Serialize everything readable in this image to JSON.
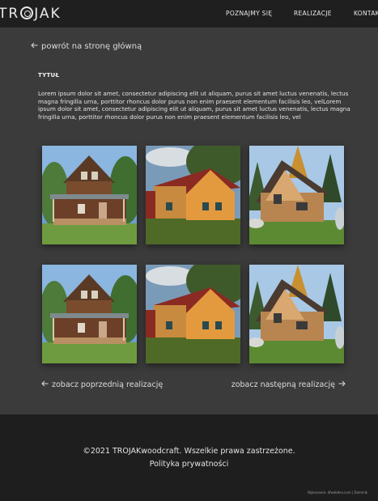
{
  "header": {
    "logo_prefix": "TR",
    "logo_suffix": "JAK",
    "nav": [
      {
        "label": "POZNAJMY SIĘ"
      },
      {
        "label": "REALIZACJE"
      },
      {
        "label": "KONTAKT"
      }
    ]
  },
  "back_link": {
    "icon": "arrow-left-icon",
    "label": "powrót na stronę główną"
  },
  "project": {
    "title": "TYTUŁ",
    "description": "Lorem ipsum dolor sit amet, consectetur adipiscing elit ut aliquam, purus sit amet luctus venenatis, lectus magna fringilla urna, porttitor rhoncus dolor purus non enim praesent elementum facilisis leo, velLorem ipsum dolor sit amet, consectetur adipiscing elit ut aliquam, purus sit amet luctus venenatis, lectus magna fringilla urna, porttitor rhoncus dolor purus non enim praesent elementum facilisis leo, vel"
  },
  "gallery": [
    {
      "subject": "brown-log-house-with-porch"
    },
    {
      "subject": "orange-barn-red-roof"
    },
    {
      "subject": "log-cabin-pine-trees"
    },
    {
      "subject": "brown-log-house-with-porch"
    },
    {
      "subject": "orange-barn-red-roof"
    },
    {
      "subject": "log-cabin-pine-trees"
    }
  ],
  "pager": {
    "prev_label": "zobacz poprzednią realizację",
    "next_label": "zobacz następną realizację"
  },
  "footer": {
    "copyright": "©2021 TROJAKwoodcraft. Wszelkie prawa zastrzeżone.",
    "privacy": "Polityka prywatności",
    "credit": "Wykonanie: dfwebdev.com | Dominik"
  },
  "colors": {
    "page_bg": "#3b3b3b",
    "header_bg": "#1f1f1f",
    "footer_bg": "#1e1e1e",
    "text": "#ececec"
  }
}
